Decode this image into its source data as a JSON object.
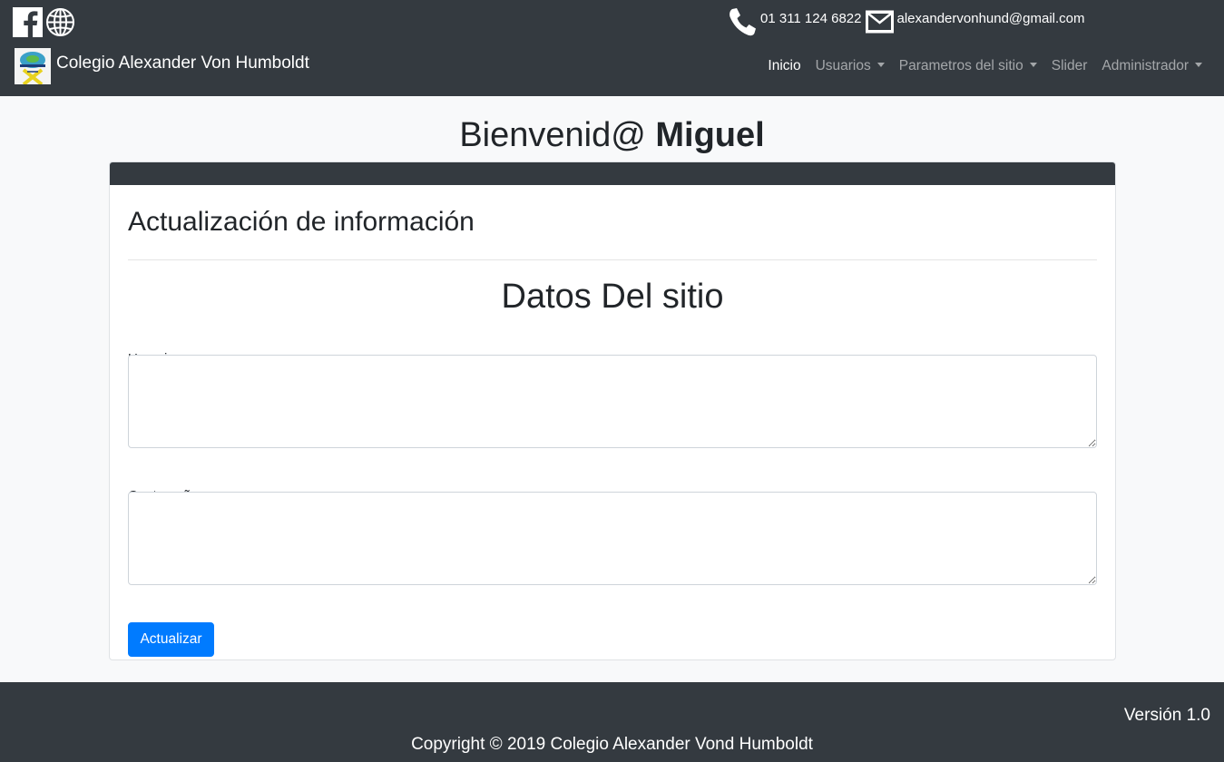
{
  "header": {
    "social": [
      {
        "icon": "facebook-icon"
      },
      {
        "icon": "globe-icon"
      }
    ],
    "contact": {
      "phone": "01 311 124 6822",
      "email": "alexandervonhund@gmail.com"
    },
    "brand": {
      "name": "Colegio Alexander Von Humboldt",
      "logo_icon": "school-logo"
    },
    "nav": [
      {
        "label": "Inicio",
        "active": true,
        "dropdown": false
      },
      {
        "label": "Usuarios",
        "active": false,
        "dropdown": true
      },
      {
        "label": "Parametros del sitio",
        "active": false,
        "dropdown": true
      },
      {
        "label": "Slider",
        "active": false,
        "dropdown": false
      },
      {
        "label": "Administrador",
        "active": false,
        "dropdown": true
      }
    ]
  },
  "main": {
    "welcome_prefix": "Bienvenid@",
    "welcome_name": "Miguel",
    "card": {
      "title": "Actualización de información",
      "subtitle": "Datos Del sitio",
      "fields": [
        {
          "label": "Usuario:",
          "value": ""
        },
        {
          "label": "Contraseña:",
          "value": ""
        }
      ],
      "submit_label": "Actualizar"
    }
  },
  "footer": {
    "version": "Versión 1.0",
    "copyright": "Copyright © 2019 Colegio Alexander Vond Humboldt"
  },
  "colors": {
    "dark": "#343a40",
    "primary": "#007bff",
    "background": "#f8f9fa"
  }
}
